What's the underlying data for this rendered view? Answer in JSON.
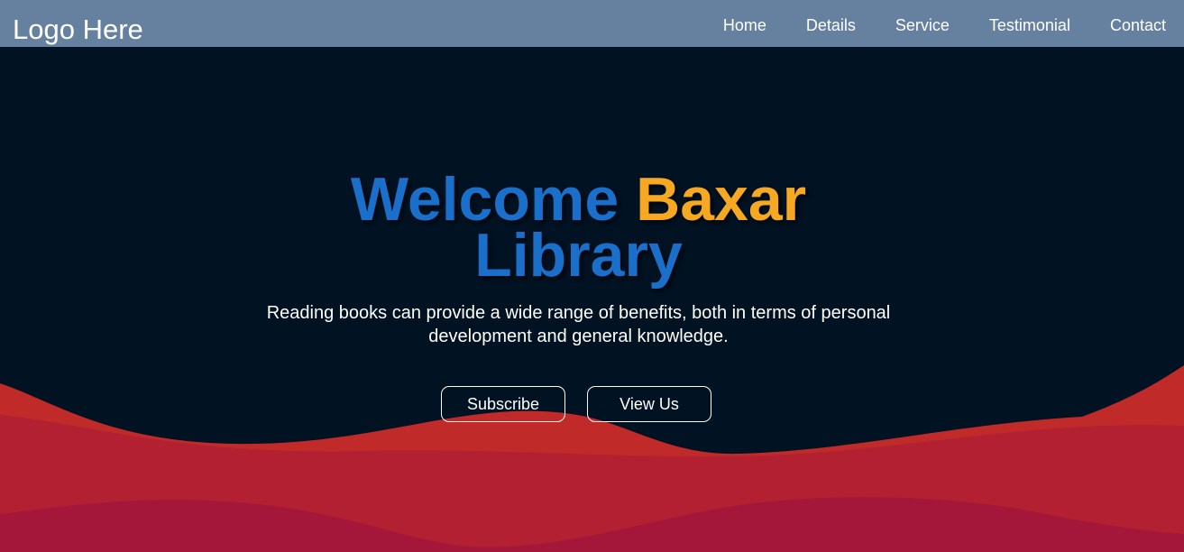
{
  "header": {
    "logo": "Logo Here",
    "nav": [
      "Home",
      "Details",
      "Service",
      "Testimonial",
      "Contact"
    ]
  },
  "hero": {
    "title_part1": "Welcome",
    "title_part2": "Baxar",
    "title_part3": "Library",
    "subtitle": "Reading books can provide a wide range of benefits, both in terms of personal development and general knowledge.",
    "buttons": [
      "Subscribe",
      "View Us"
    ]
  },
  "colors": {
    "nav_bg": "#66809f",
    "page_bg": "#011222",
    "title_blue": "#1a6fcb",
    "title_orange": "#f6a823",
    "wave_red_light": "#c02b2a",
    "wave_red_mid": "#b22031",
    "wave_red_dark": "#a5173a"
  }
}
